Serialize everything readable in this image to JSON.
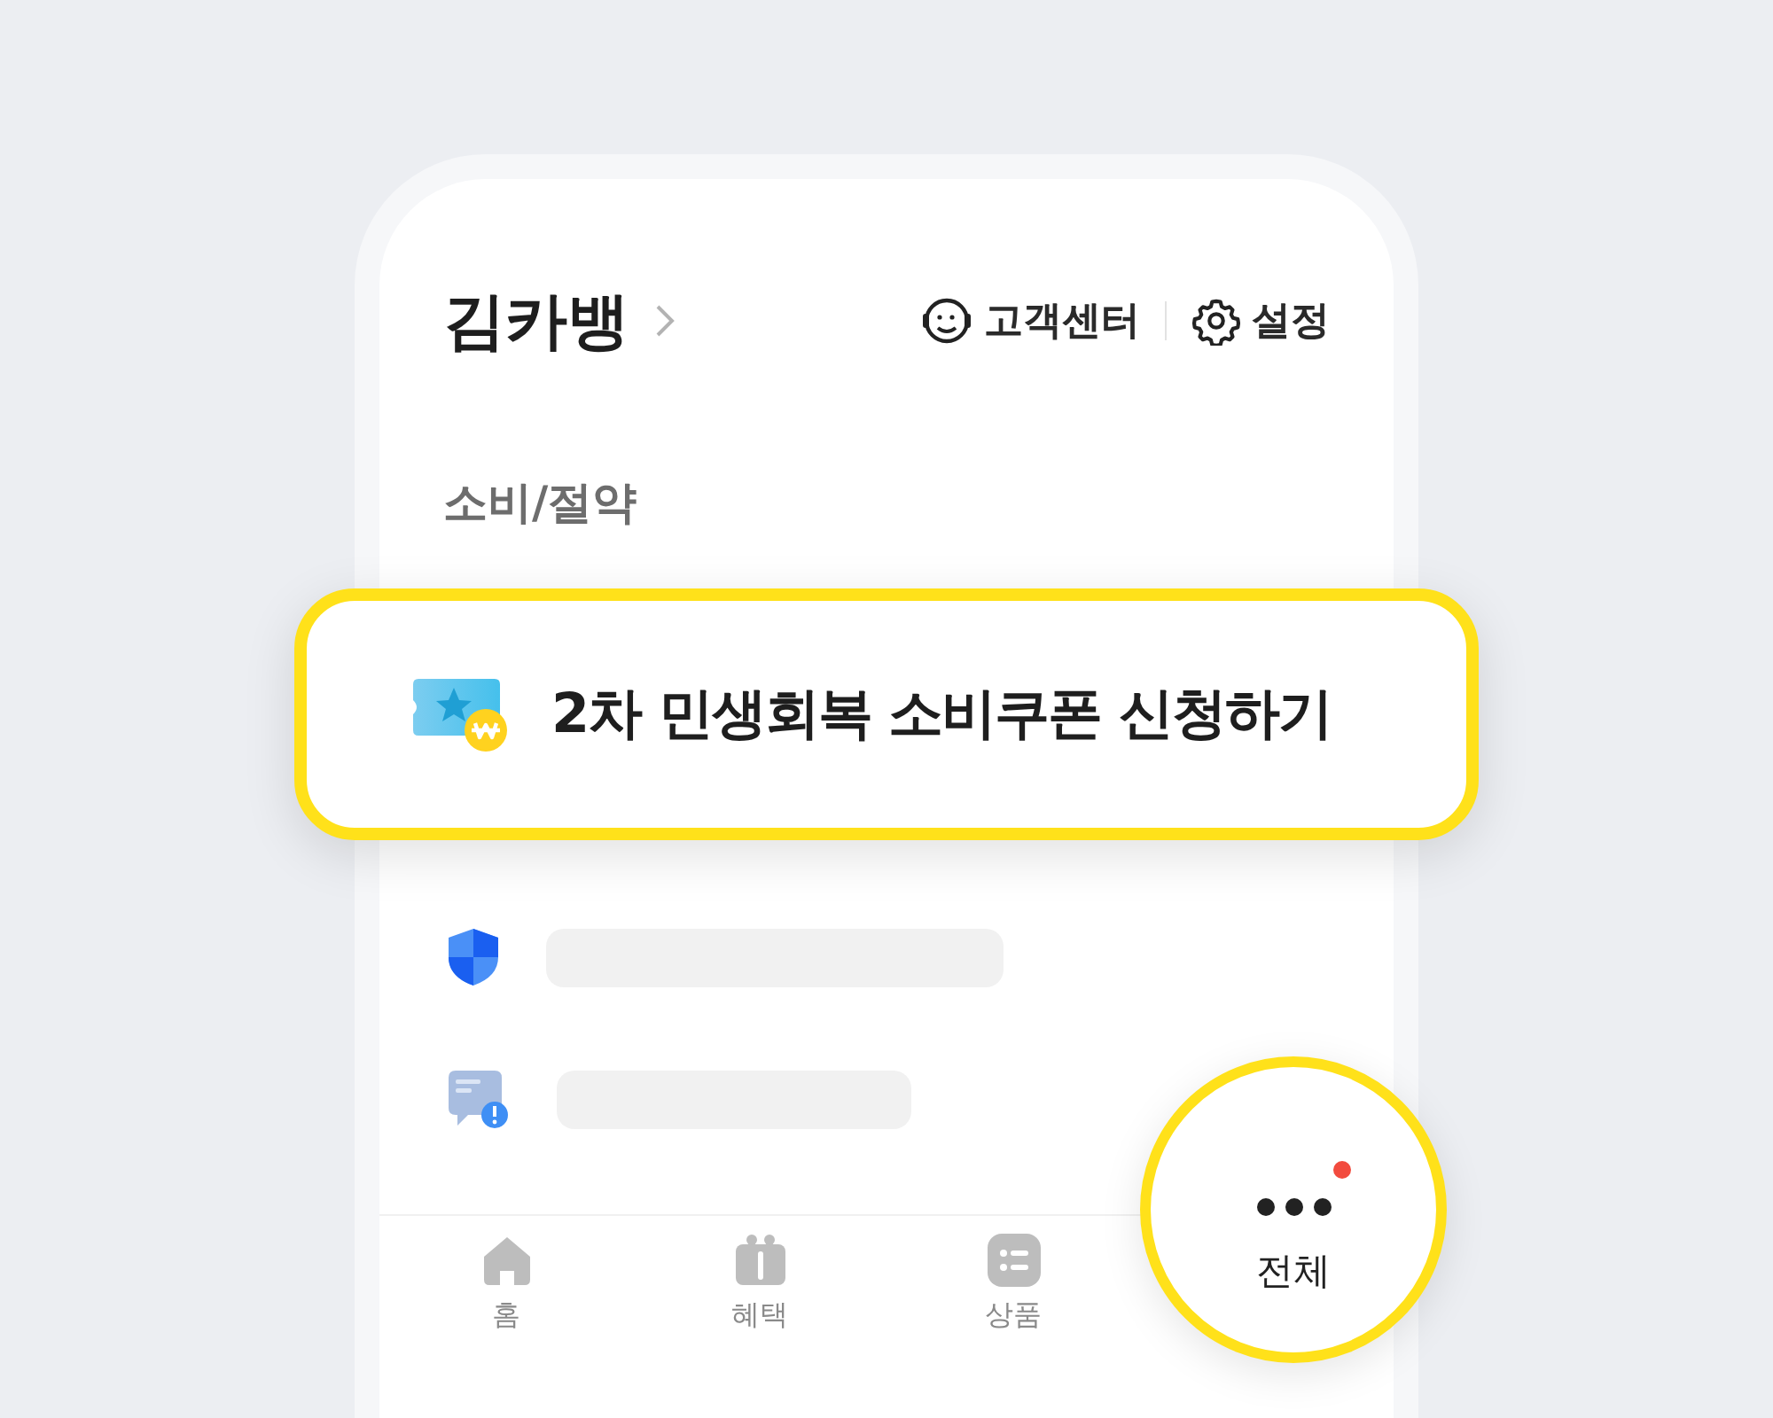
{
  "header": {
    "name": "김카뱅",
    "links": [
      {
        "label": "고객센터"
      },
      {
        "label": "설정"
      }
    ]
  },
  "section_title": "소비/절약",
  "highlight_card": {
    "label": "2차 민생회복 소비쿠폰 신청하기"
  },
  "bottom_nav": [
    {
      "label": "홈",
      "selected": false
    },
    {
      "label": "혜택",
      "selected": false
    },
    {
      "label": "상품",
      "selected": false
    }
  ],
  "all_menu": {
    "label": "전체",
    "has_notice": true
  }
}
